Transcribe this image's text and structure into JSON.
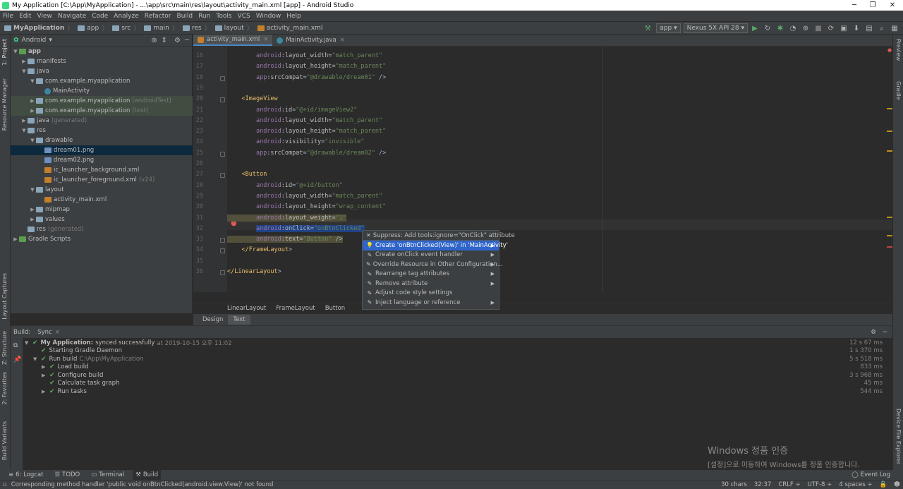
{
  "window": {
    "title": "My Application [C:\\App\\MyApplication] - ...\\app\\src\\main\\res\\layout\\activity_main.xml [app] - Android Studio"
  },
  "menu": [
    "File",
    "Edit",
    "View",
    "Navigate",
    "Code",
    "Analyze",
    "Refactor",
    "Build",
    "Run",
    "Tools",
    "VCS",
    "Window",
    "Help"
  ],
  "breadcrumb": [
    "MyApplication",
    "app",
    "src",
    "main",
    "res",
    "layout",
    "activity_main.xml"
  ],
  "toolbar": {
    "config": "app",
    "device": "Nexus 5X API 28"
  },
  "project": {
    "view": "Android",
    "tree": [
      {
        "label": "app",
        "depth": 0,
        "arrow": "▼",
        "kind": "module"
      },
      {
        "label": "manifests",
        "depth": 1,
        "arrow": "▶",
        "kind": "folder"
      },
      {
        "label": "java",
        "depth": 1,
        "arrow": "▼",
        "kind": "folder"
      },
      {
        "label": "com.example.myapplication",
        "depth": 2,
        "arrow": "▼",
        "kind": "package"
      },
      {
        "label": "MainActivity",
        "depth": 3,
        "arrow": "",
        "kind": "class"
      },
      {
        "label": "com.example.myapplication",
        "suffix": "(androidTest)",
        "depth": 2,
        "arrow": "▶",
        "kind": "package",
        "hl": true
      },
      {
        "label": "com.example.myapplication",
        "suffix": "(test)",
        "depth": 2,
        "arrow": "▶",
        "kind": "package",
        "hl": true
      },
      {
        "label": "java",
        "suffix": "(generated)",
        "depth": 1,
        "arrow": "▶",
        "kind": "folder"
      },
      {
        "label": "res",
        "depth": 1,
        "arrow": "▼",
        "kind": "folder"
      },
      {
        "label": "drawable",
        "depth": 2,
        "arrow": "▼",
        "kind": "folder"
      },
      {
        "label": "dream01.png",
        "depth": 3,
        "arrow": "",
        "kind": "image",
        "sel": true
      },
      {
        "label": "dream02.png",
        "depth": 3,
        "arrow": "",
        "kind": "image"
      },
      {
        "label": "ic_launcher_background.xml",
        "depth": 3,
        "arrow": "",
        "kind": "xml"
      },
      {
        "label": "ic_launcher_foreground.xml",
        "suffix": "(v24)",
        "depth": 3,
        "arrow": "",
        "kind": "xml"
      },
      {
        "label": "layout",
        "depth": 2,
        "arrow": "▼",
        "kind": "folder"
      },
      {
        "label": "activity_main.xml",
        "depth": 3,
        "arrow": "",
        "kind": "xml"
      },
      {
        "label": "mipmap",
        "depth": 2,
        "arrow": "▶",
        "kind": "folder"
      },
      {
        "label": "values",
        "depth": 2,
        "arrow": "▶",
        "kind": "folder"
      },
      {
        "label": "res",
        "suffix": "(generated)",
        "depth": 1,
        "arrow": "",
        "kind": "folder"
      },
      {
        "label": "Gradle Scripts",
        "depth": 0,
        "arrow": "▶",
        "kind": "gradle"
      }
    ]
  },
  "tabs": [
    {
      "label": "activity_main.xml",
      "active": true
    },
    {
      "label": "MainActivity.java",
      "active": false
    }
  ],
  "code": {
    "line_numbers": [
      "16",
      "17",
      "18",
      "19",
      "20",
      "21",
      "22",
      "23",
      "24",
      "25",
      "26",
      "27",
      "28",
      "29",
      "30",
      "31",
      "32",
      "33",
      "34",
      "35",
      "36"
    ],
    "lines": [
      "        android:layout_width=\"match_parent\"",
      "        android:layout_height=\"match_parent\"",
      "        app:srcCompat=\"@drawable/dream01\" />",
      "",
      "    <ImageView",
      "        android:id=\"@+id/imageView2\"",
      "        android:layout_width=\"match_parent\"",
      "        android:layout_height=\"match_parent\"",
      "        android:visibility=\"invisible\"",
      "        app:srcCompat=\"@drawable/dream02\" />",
      "",
      "    <Button",
      "        android:id=\"@+id/button\"",
      "        android:layout_width=\"match_parent\"",
      "        android:layout_height=\"wrap_content\"",
      "        android:layout_weight=\"1\"",
      "        android:onClick=\"onBtnClicked\"",
      "        android:text=\"Button\" />",
      "    </FrameLayout>",
      "",
      "</LinearLayout>"
    ]
  },
  "editor_breadcrumb": [
    "LinearLayout",
    "FrameLayout",
    "Button"
  ],
  "design_tabs": [
    "Design",
    "Text"
  ],
  "popup": [
    {
      "icon": "✕",
      "label": "Suppress: Add tools:ignore=\"OnClick\" attribute",
      "sub": false
    },
    {
      "icon": "💡",
      "label": "Create 'onBtnClicked(View)' in 'MainActivity'",
      "sub": true,
      "active": true
    },
    {
      "icon": "✎",
      "label": "Create onClick event handler",
      "sub": true
    },
    {
      "icon": "✎",
      "label": "Override Resource in Other Configuration...",
      "sub": true
    },
    {
      "icon": "✎",
      "label": "Rearrange tag attributes",
      "sub": true
    },
    {
      "icon": "✎",
      "label": "Remove attribute",
      "sub": true
    },
    {
      "icon": "✎",
      "label": "Adjust code style settings",
      "sub": false
    },
    {
      "icon": "✎",
      "label": "Inject language or reference",
      "sub": true
    }
  ],
  "build": {
    "tabs": [
      "Build:",
      "Sync"
    ],
    "rows": [
      {
        "label": "My Application:",
        "rest": "synced successfully",
        "dim": "at 2019-10-15 오후 11:02",
        "depth": 0,
        "arrow": "▼",
        "time": "12 s 67 ms",
        "bold": true
      },
      {
        "label": "Starting Gradle Daemon",
        "depth": 1,
        "arrow": "",
        "time": "1 s 370 ms"
      },
      {
        "label": "Run build",
        "dim": "C:\\App\\MyApplication",
        "depth": 1,
        "arrow": "▼",
        "time": "5 s 518 ms"
      },
      {
        "label": "Load build",
        "depth": 2,
        "arrow": "▶",
        "time": "833 ms"
      },
      {
        "label": "Configure build",
        "depth": 2,
        "arrow": "▶",
        "time": "3 s 968 ms"
      },
      {
        "label": "Calculate task graph",
        "depth": 2,
        "arrow": "",
        "time": "45 ms"
      },
      {
        "label": "Run tasks",
        "depth": 2,
        "arrow": "▶",
        "time": "544 ms"
      }
    ]
  },
  "bottom_tabs": [
    "6: Logcat",
    "TODO",
    "Terminal",
    "Build"
  ],
  "event_log": "Event Log",
  "status": {
    "message": "Corresponding method handler 'public void onBtnClicked(android.view.View)' not found",
    "chars": "30 chars",
    "pos": "32:37",
    "crlf": "CRLF ÷",
    "enc": "UTF-8 ÷",
    "indent": "4 spaces ÷"
  },
  "left_strip": [
    "1: Project",
    "Resource Manager",
    "Layout Captures",
    "Z: Structure",
    "2: Favorites",
    "Build Variants"
  ],
  "right_strip": [
    "Preview",
    "Gradle",
    "Device File Explorer"
  ],
  "watermark": {
    "line1": "Windows 정품 인증",
    "line2": "[설정]으로 이동하여 Windows를 정품 인증합니다."
  }
}
